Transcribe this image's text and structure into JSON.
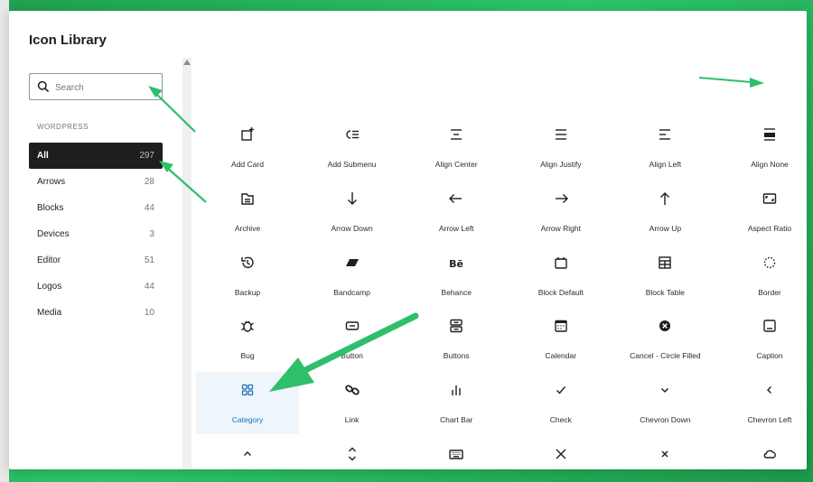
{
  "modal": {
    "title": "Icon Library"
  },
  "search": {
    "placeholder": "Search",
    "value": ""
  },
  "sidebar": {
    "section_label": "WORDPRESS",
    "categories": [
      {
        "label": "All",
        "count": "297",
        "active": true
      },
      {
        "label": "Arrows",
        "count": "28"
      },
      {
        "label": "Blocks",
        "count": "44"
      },
      {
        "label": "Devices",
        "count": "3"
      },
      {
        "label": "Editor",
        "count": "51"
      },
      {
        "label": "Logos",
        "count": "44"
      },
      {
        "label": "Media",
        "count": "10"
      }
    ]
  },
  "colors": {
    "selected_label": "#2271b1",
    "selected_bg": "#eef6fb",
    "annotation_arrow": "#2fbf6b",
    "active_category_bg": "#1e1e1e"
  },
  "icons": [
    {
      "label": "Add Card",
      "icon": "add-card-icon"
    },
    {
      "label": "Add Submenu",
      "icon": "add-submenu-icon"
    },
    {
      "label": "Align Center",
      "icon": "align-center-icon"
    },
    {
      "label": "Align Justify",
      "icon": "align-justify-icon"
    },
    {
      "label": "Align Left",
      "icon": "align-left-icon"
    },
    {
      "label": "Align None",
      "icon": "align-none-icon"
    },
    {
      "label": "Archive",
      "icon": "archive-icon"
    },
    {
      "label": "Arrow Down",
      "icon": "arrow-down-icon"
    },
    {
      "label": "Arrow Left",
      "icon": "arrow-left-icon"
    },
    {
      "label": "Arrow Right",
      "icon": "arrow-right-icon"
    },
    {
      "label": "Arrow Up",
      "icon": "arrow-up-icon"
    },
    {
      "label": "Aspect Ratio",
      "icon": "aspect-ratio-icon"
    },
    {
      "label": "Backup",
      "icon": "backup-icon"
    },
    {
      "label": "Bandcamp",
      "icon": "bandcamp-icon"
    },
    {
      "label": "Behance",
      "icon": "behance-icon"
    },
    {
      "label": "Block Default",
      "icon": "block-default-icon"
    },
    {
      "label": "Block Table",
      "icon": "block-table-icon"
    },
    {
      "label": "Border",
      "icon": "border-icon"
    },
    {
      "label": "Bug",
      "icon": "bug-icon"
    },
    {
      "label": "Button",
      "icon": "button-icon"
    },
    {
      "label": "Buttons",
      "icon": "buttons-icon"
    },
    {
      "label": "Calendar",
      "icon": "calendar-icon"
    },
    {
      "label": "Cancel - Circle Filled",
      "icon": "cancel-circle-filled-icon"
    },
    {
      "label": "Caption",
      "icon": "caption-icon"
    },
    {
      "label": "Category",
      "icon": "category-icon",
      "selected": true
    },
    {
      "label": "Link",
      "icon": "link-icon"
    },
    {
      "label": "Chart Bar",
      "icon": "chart-bar-icon"
    },
    {
      "label": "Check",
      "icon": "check-icon"
    },
    {
      "label": "Chevron Down",
      "icon": "chevron-down-icon"
    },
    {
      "label": "Chevron Left",
      "icon": "chevron-left-icon"
    },
    {
      "label": "",
      "icon": "chevron-up-icon"
    },
    {
      "label": "",
      "icon": "chevron-up-down-icon"
    },
    {
      "label": "",
      "icon": "keyboard-icon"
    },
    {
      "label": "",
      "icon": "close-icon"
    },
    {
      "label": "",
      "icon": "close-small-icon"
    },
    {
      "label": "",
      "icon": "cloud-icon"
    }
  ]
}
